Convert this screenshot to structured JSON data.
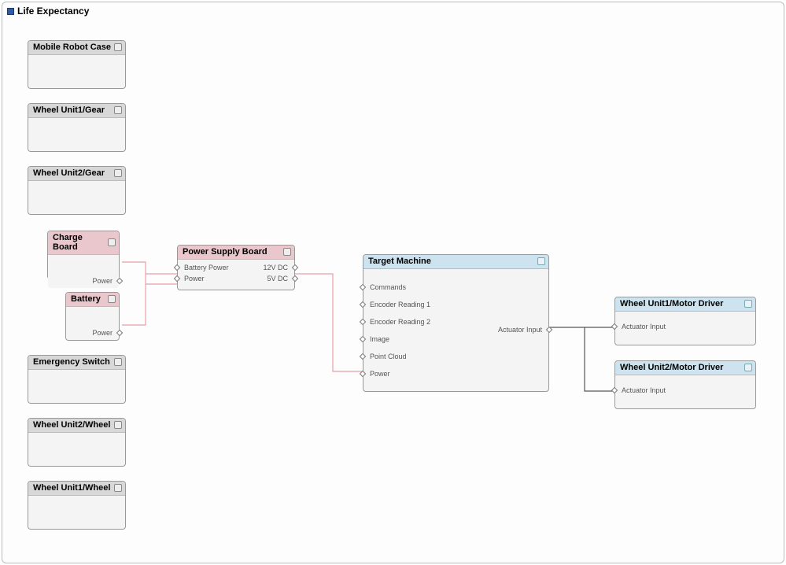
{
  "panel": {
    "title": "Life Expectancy"
  },
  "colors": {
    "pink_wire": "#e7a0ab",
    "dark_wire": "#555"
  },
  "nodes": {
    "mobile_robot_case": {
      "title": "Mobile Robot Case"
    },
    "wheel_unit1_gear": {
      "title": "Wheel Unit1/Gear"
    },
    "wheel_unit2_gear": {
      "title": "Wheel Unit2/Gear"
    },
    "charge_board": {
      "title": "Charge Board",
      "port_power": "Power"
    },
    "battery": {
      "title": "Battery",
      "port_power": "Power"
    },
    "emergency_switch": {
      "title": "Emergency Switch"
    },
    "wheel_unit2_wheel": {
      "title": "Wheel Unit2/Wheel"
    },
    "wheel_unit1_wheel": {
      "title": "Wheel Unit1/Wheel"
    },
    "power_supply": {
      "title": "Power Supply Board",
      "in_battery": "Battery Power",
      "in_power": "Power",
      "out_12v": "12V DC",
      "out_5v": "5V DC"
    },
    "target_machine": {
      "title": "Target Machine",
      "in_commands": "Commands",
      "in_enc1": "Encoder Reading 1",
      "in_enc2": "Encoder Reading 2",
      "in_image": "Image",
      "in_pointcloud": "Point Cloud",
      "in_power": "Power",
      "out_actuator": "Actuator Input"
    },
    "wheel1_driver": {
      "title": "Wheel Unit1/Motor Driver",
      "in_actuator": "Actuator Input"
    },
    "wheel2_driver": {
      "title": "Wheel Unit2/Motor Driver",
      "in_actuator": "Actuator Input"
    }
  }
}
